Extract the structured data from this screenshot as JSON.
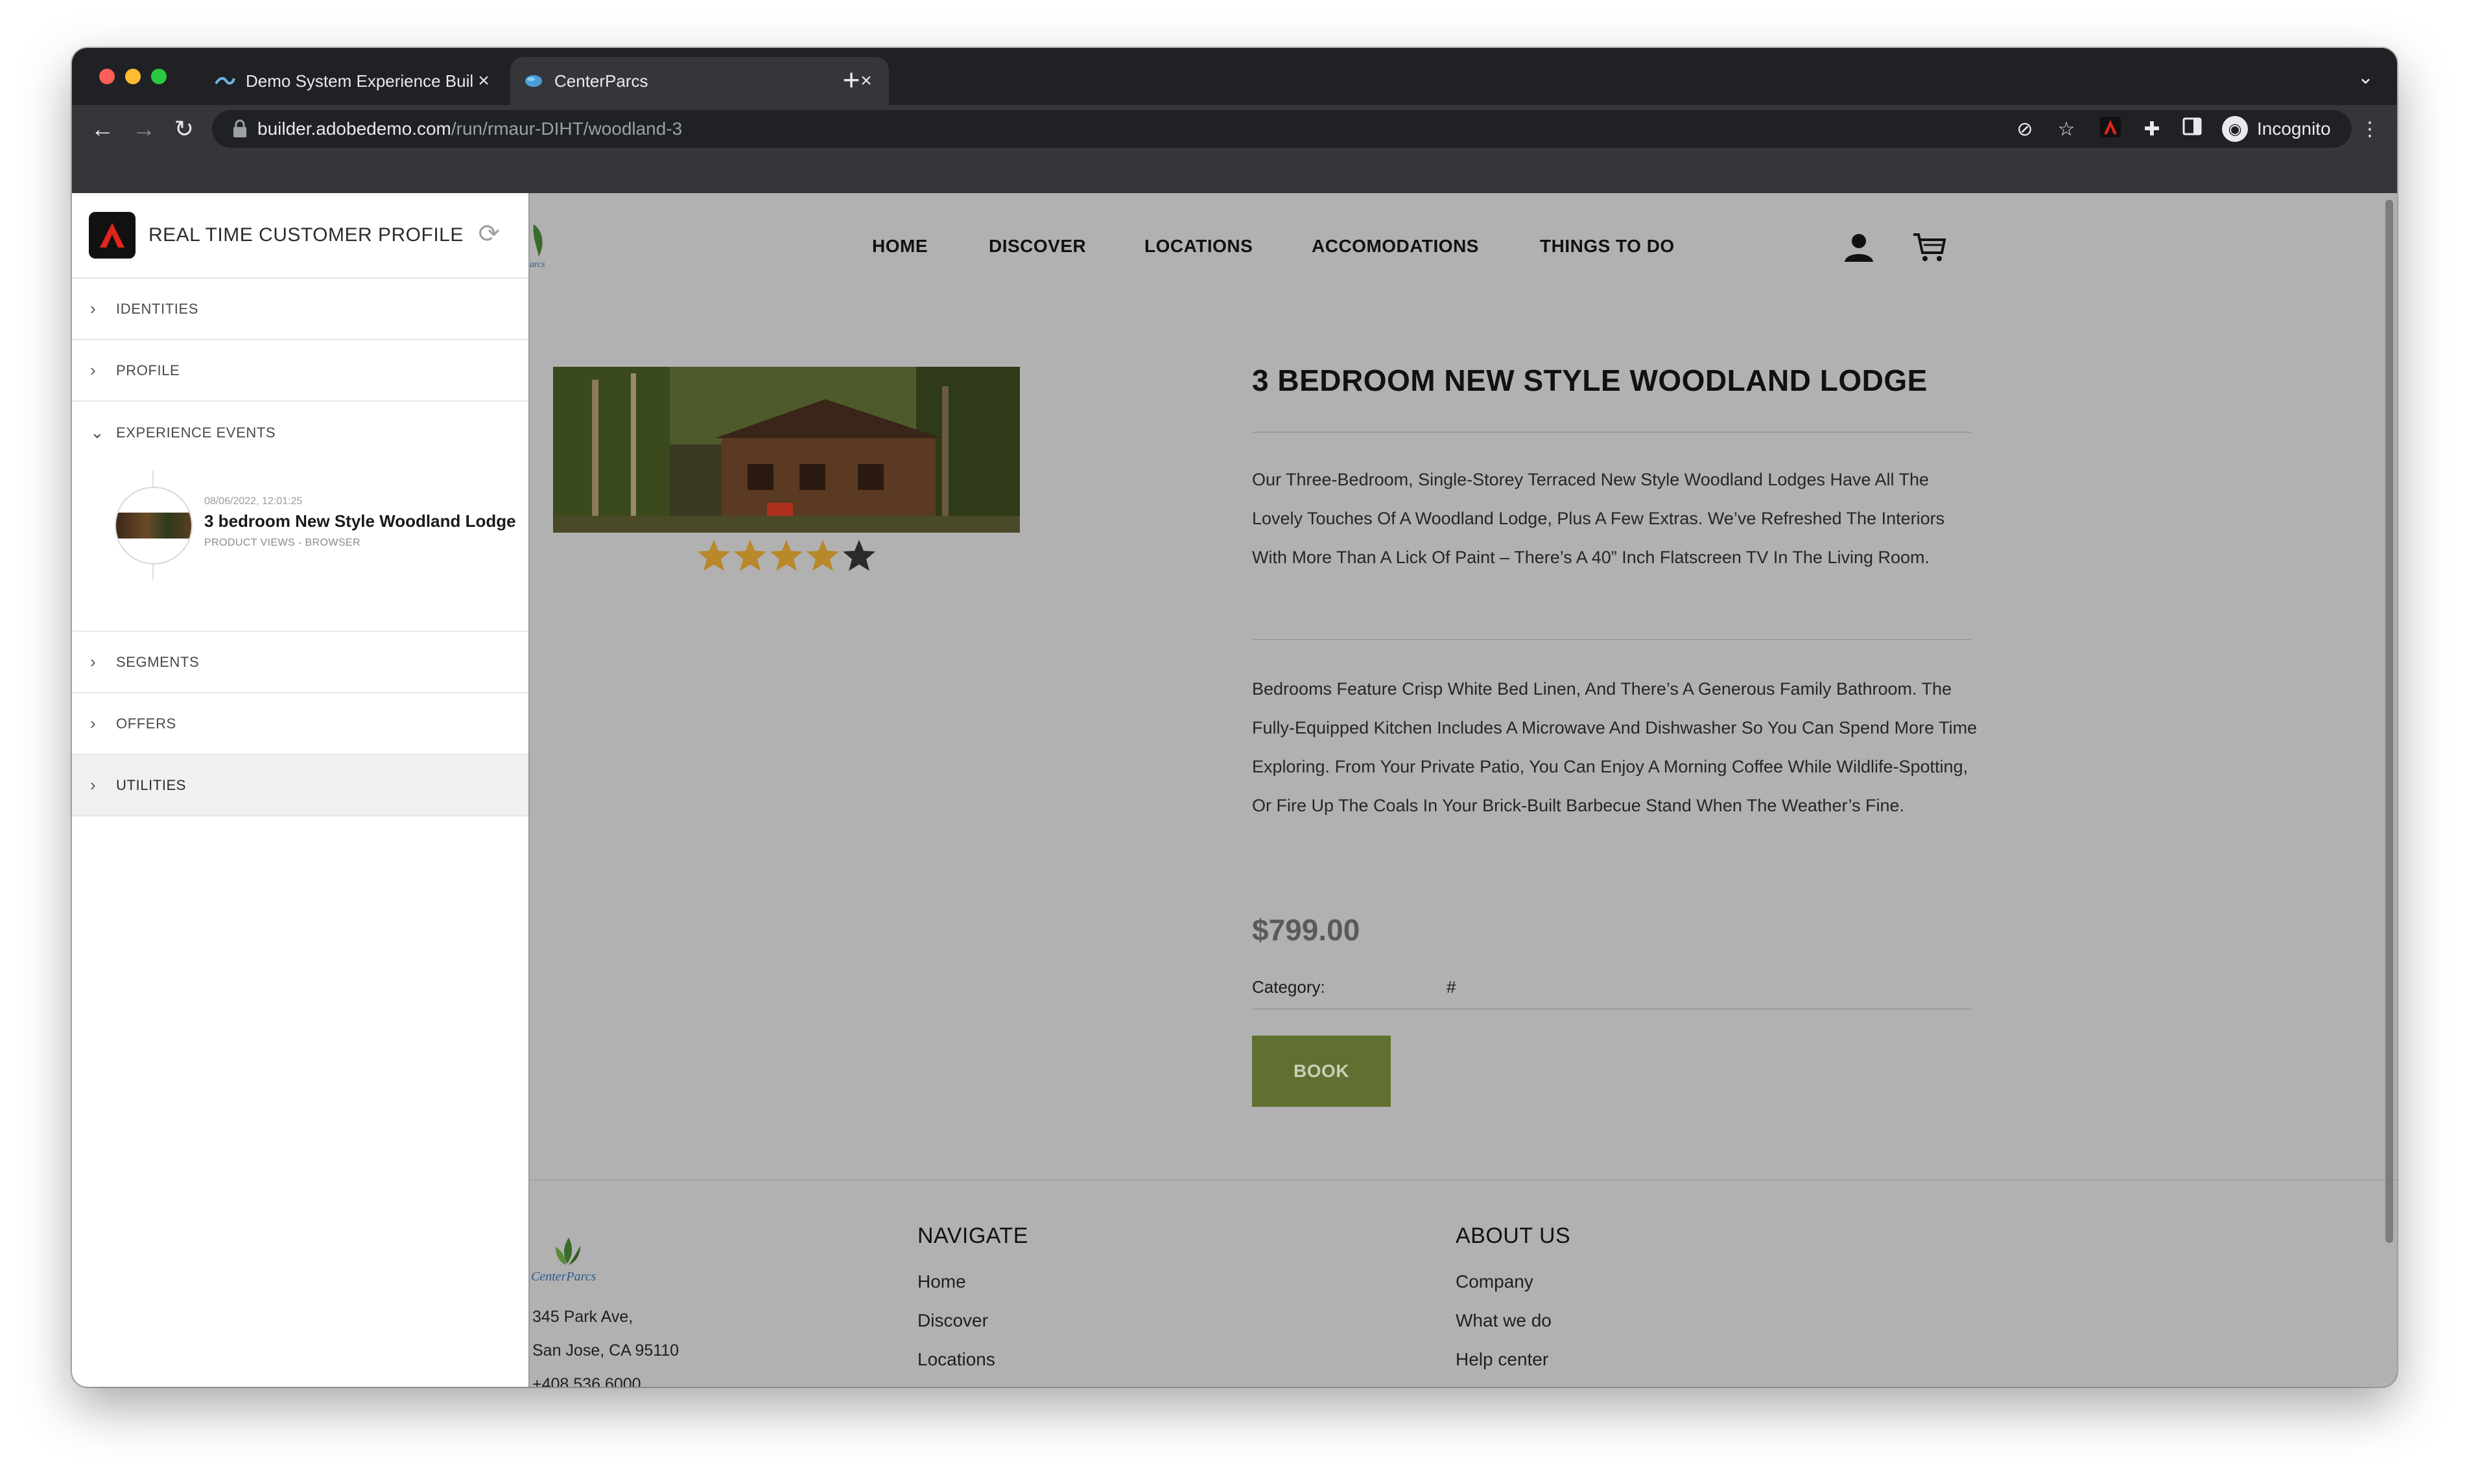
{
  "browser": {
    "tabs": [
      {
        "title": "Demo System Experience Buil",
        "active": false
      },
      {
        "title": "CenterParcs",
        "active": true
      }
    ],
    "new_tab": "+",
    "url_host": "builder.adobedemo.com",
    "url_path": "/run/rmaur-DIHT/woodland-3",
    "profile_label": "Incognito"
  },
  "side_panel": {
    "title": "REAL TIME CUSTOMER PROFILE",
    "sections": {
      "identities": "IDENTITIES",
      "profile": "PROFILE",
      "experience_events": "EXPERIENCE EVENTS",
      "segments": "SEGMENTS",
      "offers": "OFFERS",
      "utilities": "UTILITIES"
    },
    "event": {
      "date": "08/06/2022, 12:01:25",
      "title": "3 bedroom New Style Woodland Lodge",
      "subtitle": "PRODUCT VIEWS - BROWSER"
    }
  },
  "site": {
    "nav": {
      "home": "HOME",
      "discover": "DISCOVER",
      "locations": "LOCATIONS",
      "accommodations": "ACCOMODATIONS",
      "things_to_do": "THINGS TO DO"
    },
    "product": {
      "title": "3 BEDROOM NEW STYLE WOODLAND LODGE",
      "rating": 4,
      "rating_max": 5,
      "description_1": "Our Three-Bedroom, Single-Storey Terraced New Style Woodland Lodges Have All The Lovely Touches Of A Woodland Lodge, Plus A Few Extras. We’ve Refreshed The Interiors With More Than A Lick Of Paint – There’s A 40” Inch Flatscreen TV In The Living Room.",
      "description_2": "Bedrooms Feature Crisp White Bed Linen, And There’s A Generous Family Bathroom. The Fully-Equipped Kitchen Includes A Microwave And Dishwasher So You Can Spend More Time Exploring. From Your Private Patio, You Can Enjoy A Morning Coffee While Wildlife-Spotting, Or Fire Up The Coals In Your Brick-Built Barbecue Stand When The Weather’s Fine.",
      "price": "$799.00",
      "category_label": "Category:",
      "category_value": "#",
      "book_label": "BOOK"
    },
    "footer": {
      "logo_text": "CenterParcs",
      "address_line1": "345 Park Ave,",
      "address_line2": "San Jose, CA 95110",
      "phone": "+408 536 6000",
      "navigate_heading": "NAVIGATE",
      "navigate_links": [
        "Home",
        "Discover",
        "Locations"
      ],
      "about_heading": "ABOUT US",
      "about_links": [
        "Company",
        "What we do",
        "Help center"
      ]
    }
  },
  "colors": {
    "book_button": "#607030",
    "star_filled": "#b8882a",
    "star_empty": "#2a2a2a",
    "page_overlay": "#b1b1b1"
  }
}
